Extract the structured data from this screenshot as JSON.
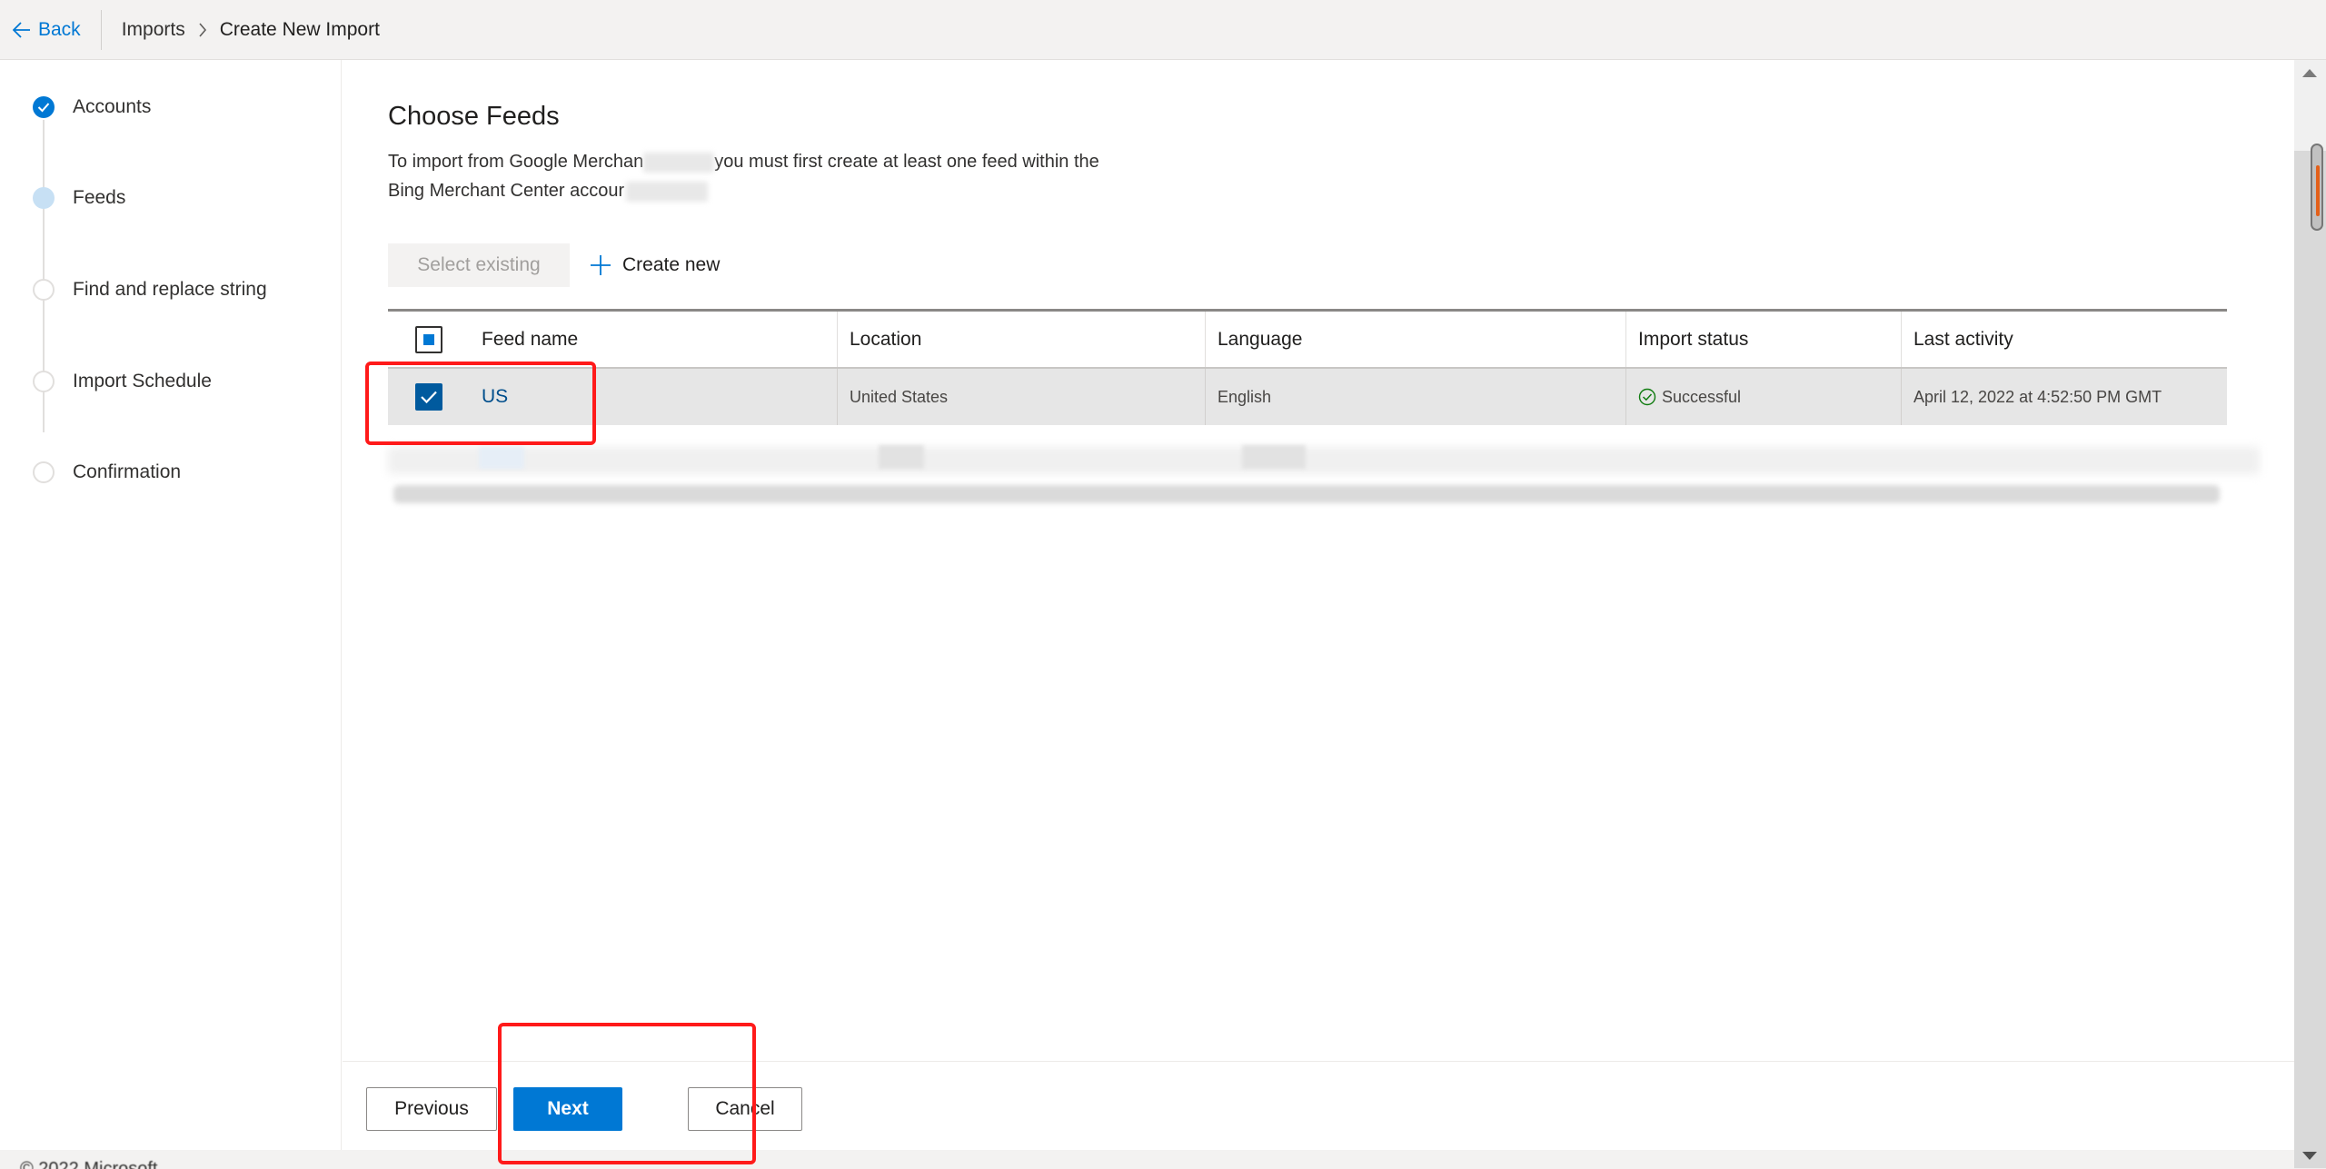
{
  "header": {
    "back_label": "Back",
    "breadcrumb": [
      "Imports",
      "Create New Import"
    ]
  },
  "stepper": {
    "steps": [
      {
        "label": "Accounts",
        "state": "done"
      },
      {
        "label": "Feeds",
        "state": "current"
      },
      {
        "label": "Find and replace string",
        "state": "todo"
      },
      {
        "label": "Import Schedule",
        "state": "todo"
      },
      {
        "label": "Confirmation",
        "state": "todo"
      }
    ]
  },
  "main": {
    "title": "Choose Feeds",
    "description_line1_a": "To import from Google Merchan",
    "description_line1_b": "you must first create at least one feed within the",
    "description_line2": "Bing Merchant Center accour",
    "select_existing_label": "Select existing",
    "create_new_label": "Create new"
  },
  "table": {
    "columns": [
      "Feed name",
      "Location",
      "Language",
      "Import status",
      "Last activity"
    ],
    "rows": [
      {
        "feed_name": "US",
        "location": "United States",
        "language": "English",
        "import_status": "Successful",
        "last_activity": "April 12, 2022 at 4:52:50 PM GMT",
        "selected": true
      }
    ]
  },
  "footer": {
    "previous_label": "Previous",
    "next_label": "Next",
    "cancel_label": "Cancel",
    "copyright": "© 2022 Microsoft"
  },
  "colors": {
    "accent": "#0078d4",
    "annotation": "#ff1a1a",
    "success": "#107c10"
  }
}
